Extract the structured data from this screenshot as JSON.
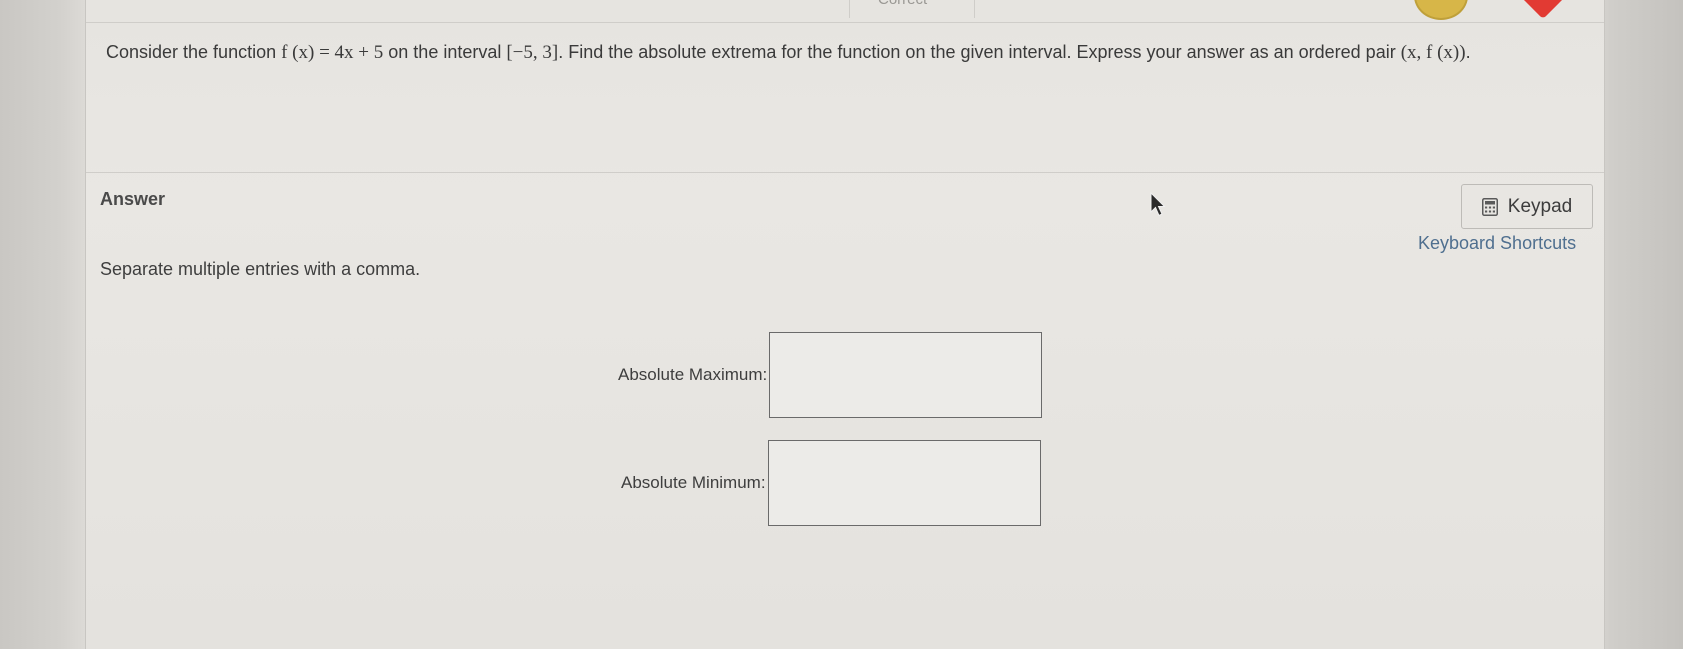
{
  "header": {
    "tab_label": "Correct"
  },
  "question": {
    "prefix": "Consider the function ",
    "function": "f (x)  =  4x + 5",
    "middle": " on the interval ",
    "interval": "[−5, 3]",
    "suffix": ". Find the absolute extrema for the function on the given interval. Express your answer as an ordered pair ",
    "pair": "(x, f (x))",
    "end": "."
  },
  "answer": {
    "heading": "Answer",
    "instructions": "Separate multiple entries with a comma.",
    "keypad_label": "Keypad",
    "shortcuts_label": "Keyboard Shortcuts",
    "fields": [
      {
        "label": "Absolute Maximum:",
        "value": ""
      },
      {
        "label": "Absolute Minimum:",
        "value": ""
      }
    ]
  },
  "colors": {
    "link": "#4f6f8f",
    "badge_yellow": "#d7b648",
    "badge_red": "#e23a33"
  },
  "icons": {
    "keypad": "calculator-icon",
    "cursor": "mouse-pointer-icon"
  }
}
